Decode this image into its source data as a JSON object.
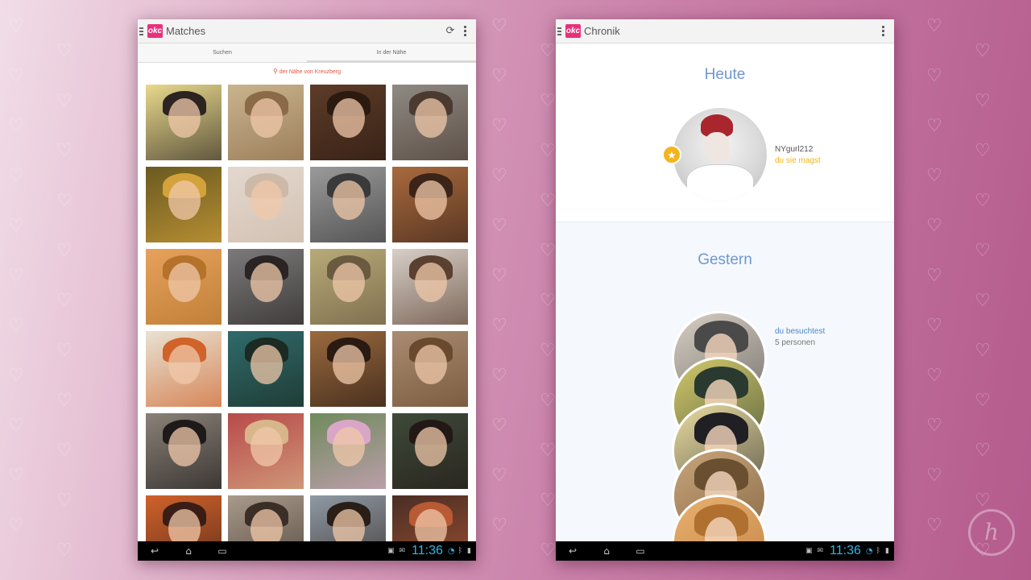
{
  "colors": {
    "brand": "#e7317b",
    "accent_blue": "#6f97cf",
    "gold": "#f4b41a",
    "location_red": "#e8553e",
    "clock_blue": "#33b5e5"
  },
  "left": {
    "logo": "okc",
    "title": "Matches",
    "refresh_icon": "refresh-icon",
    "menu_icon": "overflow-menu-icon",
    "tabs": [
      "Suchen",
      "In der Nähe"
    ],
    "active_tab": "In der Nähe",
    "location": "der Nähe von Kreuzberg",
    "photos": [
      {
        "bg": "#e8d98c",
        "fg": "#2b2420"
      },
      {
        "bg": "#c9b48e",
        "fg": "#8b6a47"
      },
      {
        "bg": "#5d3b28",
        "fg": "#2b1a10"
      },
      {
        "bg": "#8f8a84",
        "fg": "#4a3a30"
      },
      {
        "bg": "#6a5a20",
        "fg": "#d4a23a"
      },
      {
        "bg": "#e3d8cf",
        "fg": "#cdb9a8"
      },
      {
        "bg": "#9a9a9a",
        "fg": "#3a3a3a"
      },
      {
        "bg": "#a86a3e",
        "fg": "#3b2418"
      },
      {
        "bg": "#e6a25c",
        "fg": "#b4722a"
      },
      {
        "bg": "#7b7a7a",
        "fg": "#2a2424"
      },
      {
        "bg": "#b8aa78",
        "fg": "#6a5a40"
      },
      {
        "bg": "#d8cfc8",
        "fg": "#5a4030"
      },
      {
        "bg": "#e8e2d2",
        "fg": "#d0622a"
      },
      {
        "bg": "#2f6b6b",
        "fg": "#1b2a22"
      },
      {
        "bg": "#9a6a3e",
        "fg": "#2a1a12"
      },
      {
        "bg": "#a98c72",
        "fg": "#6a4a2e"
      },
      {
        "bg": "#8a8278",
        "fg": "#1f1a1a"
      },
      {
        "bg": "#b84a4a",
        "fg": "#d8b58a"
      },
      {
        "bg": "#6f8a5c",
        "fg": "#d9a6c8"
      },
      {
        "bg": "#3e4a3a",
        "fg": "#221815"
      },
      {
        "bg": "#d0622a",
        "fg": "#3a1e16"
      },
      {
        "bg": "#a89b8c",
        "fg": "#3b2e26"
      },
      {
        "bg": "#8f9aa4",
        "fg": "#2a1e18"
      },
      {
        "bg": "#4a2e24",
        "fg": "#b85a34"
      }
    ]
  },
  "right": {
    "logo": "okc",
    "title": "Chronik",
    "menu_icon": "overflow-menu-icon",
    "today_title": "Heute",
    "today_user": "NYgurl212",
    "today_action": "du sie magst",
    "star_icon": "star-icon",
    "yesterday_title": "Gestern",
    "visited_label": "du besuchtest",
    "visited_count": "5 personen",
    "visited_circles": [
      {
        "bg": "#d8cfc2",
        "fg": "#4a4a4a"
      },
      {
        "bg": "#d2c86a",
        "fg": "#2a3a30"
      },
      {
        "bg": "#e9dca0",
        "fg": "#1f1f24"
      },
      {
        "bg": "#c8a47a",
        "fg": "#6a5030"
      },
      {
        "bg": "#e8b070",
        "fg": "#b07030"
      }
    ]
  },
  "status_bar": {
    "time": "11:36",
    "back_icon": "back-icon",
    "home_icon": "home-icon",
    "recents_icon": "recents-icon"
  },
  "watermark": "h"
}
